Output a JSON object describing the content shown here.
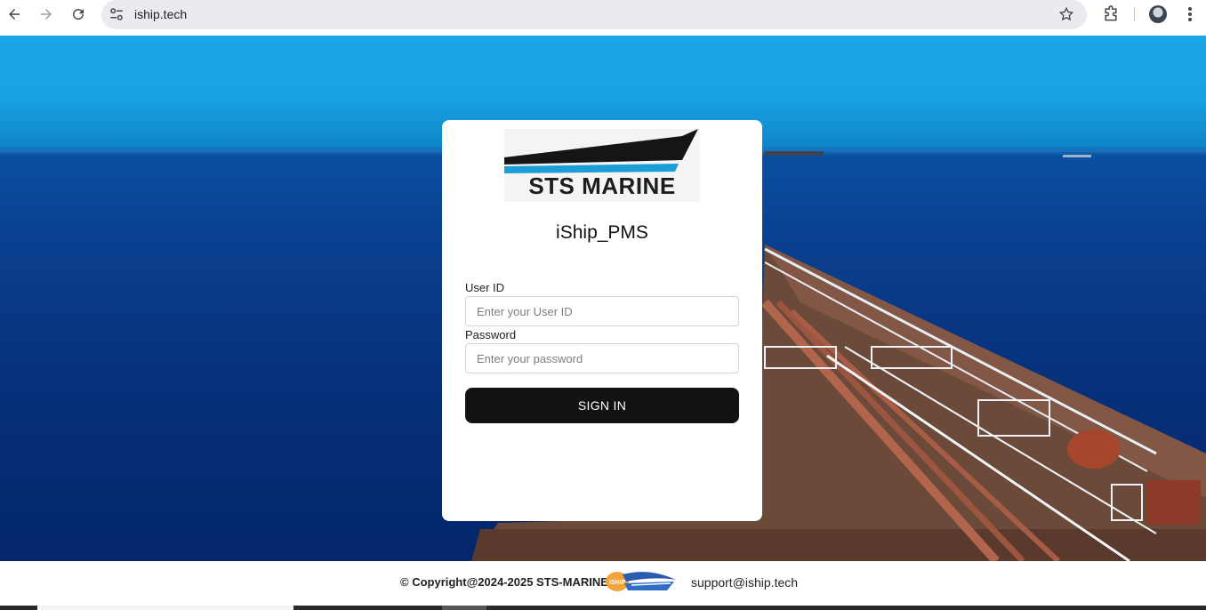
{
  "browser": {
    "url": "iship.tech",
    "icons": [
      "back-arrow-icon",
      "forward-arrow-icon",
      "reload-icon",
      "site-settings-icon",
      "bookmark-star-icon",
      "extensions-icon",
      "profile-avatar",
      "kebab-menu-icon"
    ]
  },
  "login": {
    "logo_text": "STS MARINE",
    "app_title": "iShip_PMS",
    "user_id_label": "User ID",
    "user_id_placeholder": "Enter your User ID",
    "password_label": "Password",
    "password_placeholder": "Enter your password",
    "signin_label": "SIGN IN"
  },
  "footer": {
    "copyright": "© Copyright@2024-2025 STS-MARINE",
    "logo_text": "iSHIP",
    "support_email": "support@iship.tech"
  },
  "colors": {
    "sky": "#18a2e3",
    "sea": "#0a3f8f",
    "button": "#121212",
    "logo_stripe": "#1b9ed8"
  }
}
